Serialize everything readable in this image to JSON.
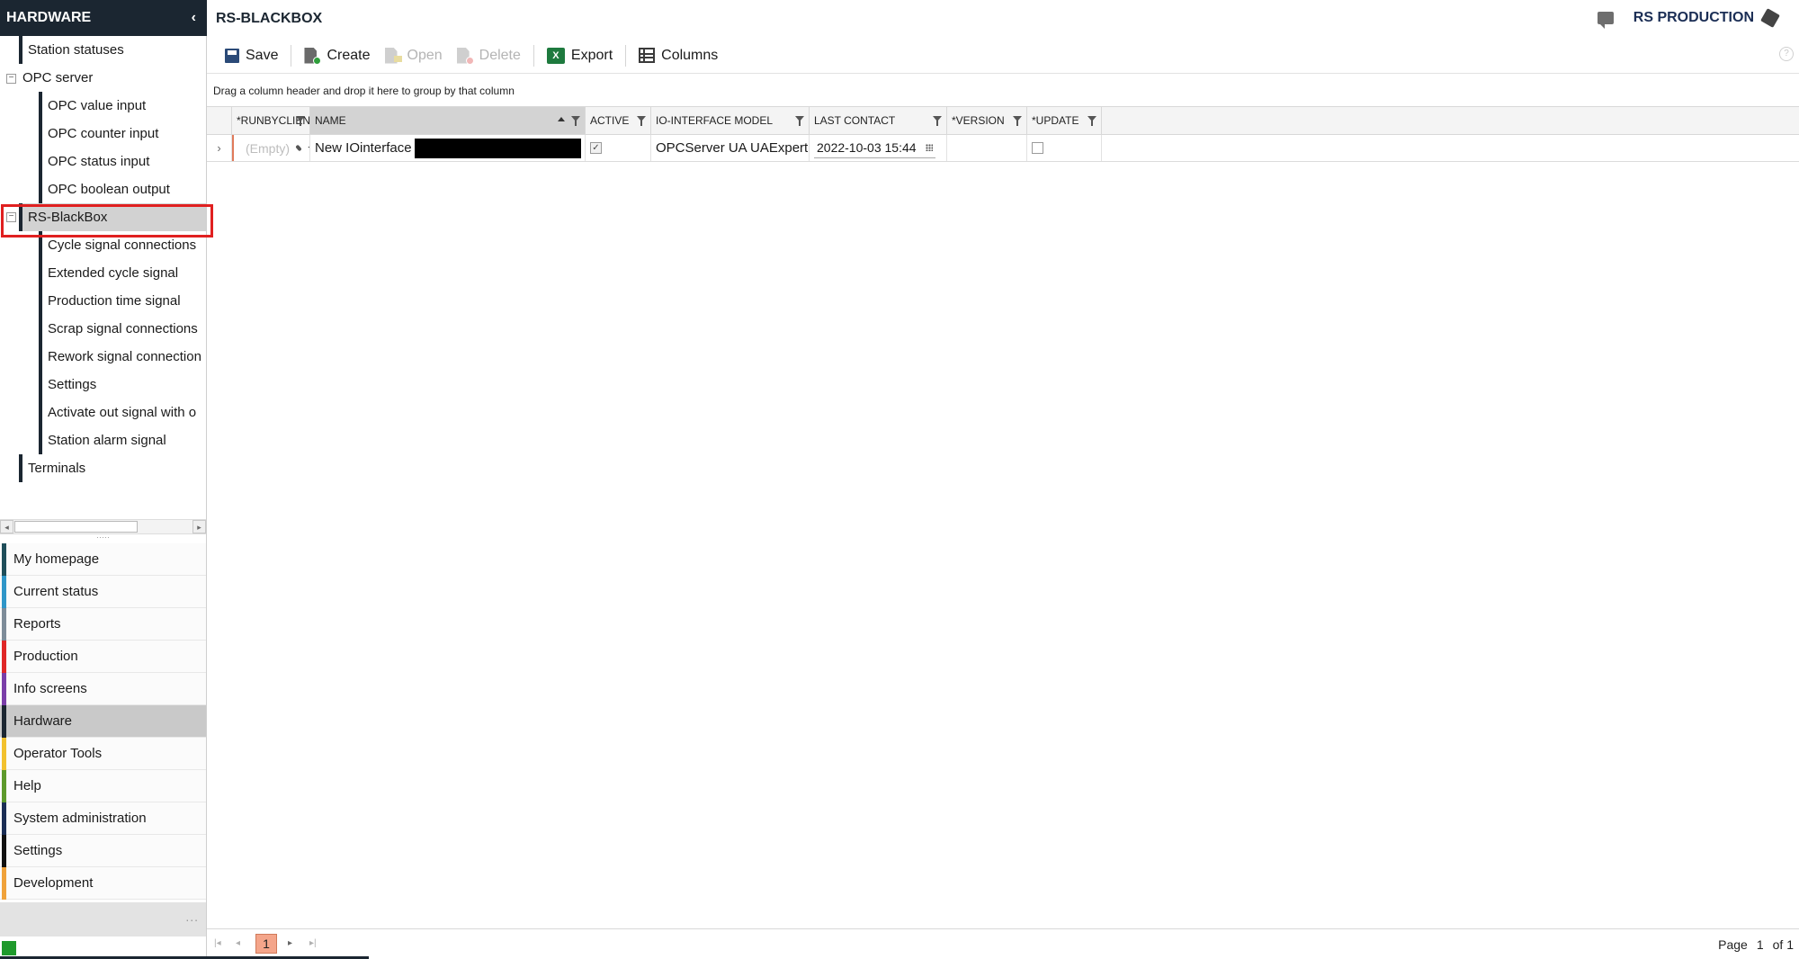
{
  "sidebar": {
    "title": "HARDWARE",
    "tree": [
      {
        "label": "Station statuses"
      },
      {
        "label": "OPC server"
      },
      {
        "label": "OPC value input"
      },
      {
        "label": "OPC counter input"
      },
      {
        "label": "OPC status input"
      },
      {
        "label": "OPC boolean output"
      },
      {
        "label": "RS-BlackBox"
      },
      {
        "label": "Cycle signal connections"
      },
      {
        "label": "Extended cycle signal"
      },
      {
        "label": "Production time signal"
      },
      {
        "label": "Scrap signal connections"
      },
      {
        "label": "Rework signal connection"
      },
      {
        "label": "Settings"
      },
      {
        "label": "Activate out signal with o"
      },
      {
        "label": "Station alarm signal"
      },
      {
        "label": "Terminals"
      }
    ],
    "toggle_collapsed": "⊟"
  },
  "nav": {
    "items": [
      {
        "label": "My homepage",
        "color": "#1f4e5a"
      },
      {
        "label": "Current status",
        "color": "#2f96c8"
      },
      {
        "label": "Reports",
        "color": "#7e8c99"
      },
      {
        "label": "Production",
        "color": "#e02727"
      },
      {
        "label": "Info screens",
        "color": "#7a3ea8"
      },
      {
        "label": "Hardware",
        "color": "#1b2631"
      },
      {
        "label": "Operator Tools",
        "color": "#f2c12e"
      },
      {
        "label": "Help",
        "color": "#5e9a2c"
      },
      {
        "label": "System administration",
        "color": "#1b2e55"
      },
      {
        "label": "Settings",
        "color": "#111111"
      },
      {
        "label": "Development",
        "color": "#f0a23a"
      }
    ],
    "more": "..."
  },
  "header": {
    "title": "RS-BLACKBOX",
    "brand": "RS PRODUCTION"
  },
  "toolbar": {
    "save": "Save",
    "create": "Create",
    "open": "Open",
    "delete": "Delete",
    "export": "Export",
    "columns": "Columns",
    "help": "?"
  },
  "grid": {
    "group_hint": "Drag a column header and drop it here to group by that column",
    "columns": [
      "*RUNBYCLIENT",
      "NAME",
      "ACTIVE",
      "IO-INTERFACE MODEL",
      "LAST CONTACT",
      "*VERSION",
      "*UPDATE"
    ],
    "rows": [
      {
        "runbyclient": "(Empty)",
        "name": "New IOinterface",
        "active": true,
        "model": "OPCServer UA UAExpert",
        "last_contact": "2022-10-03 15:44",
        "version": "",
        "update": false
      }
    ]
  },
  "pager": {
    "current": "1",
    "page_label": "Page",
    "page_value": "1",
    "of_label": "of 1"
  }
}
